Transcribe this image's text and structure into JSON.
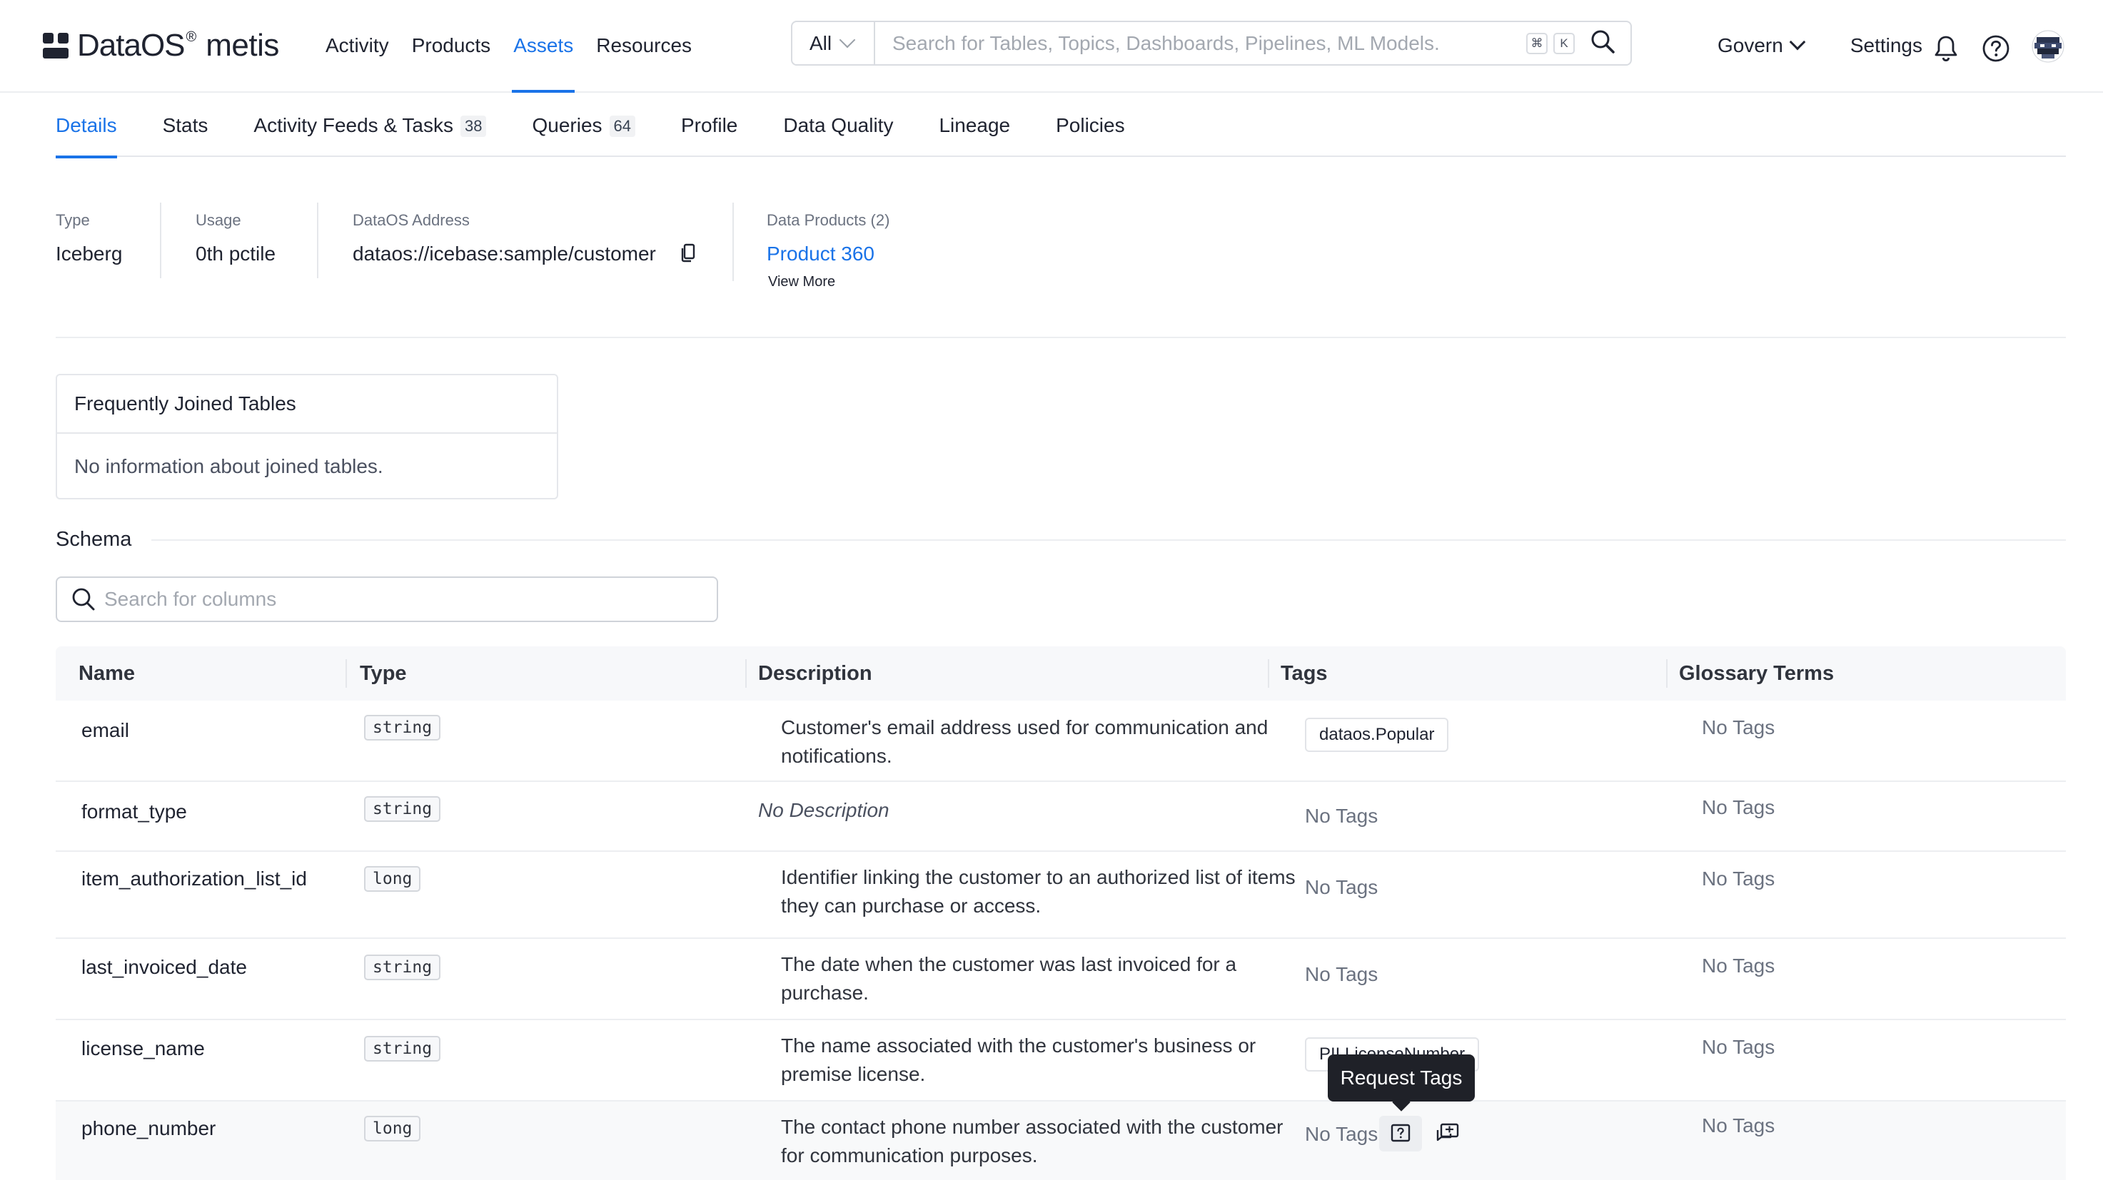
{
  "app": {
    "logo_text": "DataOS",
    "logo_reg": "®",
    "logo_suffix": "metis"
  },
  "nav": {
    "items": [
      "Activity",
      "Products",
      "Assets",
      "Resources"
    ],
    "active": "Assets"
  },
  "search": {
    "filter": "All",
    "placeholder": "Search for Tables, Topics, Dashboards, Pipelines, ML Models.",
    "shortcut_cmd": "⌘",
    "shortcut_key": "K"
  },
  "right_nav": {
    "govern": "Govern",
    "settings": "Settings"
  },
  "tabs": [
    {
      "label": "Details",
      "count": null,
      "active": true
    },
    {
      "label": "Stats",
      "count": null
    },
    {
      "label": "Activity Feeds & Tasks",
      "count": "38"
    },
    {
      "label": "Queries",
      "count": "64"
    },
    {
      "label": "Profile",
      "count": null
    },
    {
      "label": "Data Quality",
      "count": null
    },
    {
      "label": "Lineage",
      "count": null
    },
    {
      "label": "Policies",
      "count": null
    }
  ],
  "summary": {
    "type_label": "Type",
    "type_value": "Iceberg",
    "usage_label": "Usage",
    "usage_value": "0th pctile",
    "address_label": "DataOS Address",
    "address_value": "dataos://icebase:sample/customer",
    "products_label": "Data Products (2)",
    "products_value": "Product 360",
    "view_more": "View More"
  },
  "joined_tables": {
    "title": "Frequently Joined Tables",
    "empty": "No information about joined tables."
  },
  "schema": {
    "title": "Schema",
    "search_placeholder": "Search for columns",
    "columns": [
      "Name",
      "Type",
      "Description",
      "Tags",
      "Glossary Terms"
    ],
    "rows": [
      {
        "name": "email",
        "type": "string",
        "description": "Customer's email address used for communication and notifications.",
        "tag": "dataos.Popular",
        "glossary": "No Tags"
      },
      {
        "name": "format_type",
        "type": "string",
        "description": "No Description",
        "tag": "No Tags",
        "glossary": "No Tags"
      },
      {
        "name": "item_authorization_list_id",
        "type": "long",
        "description": "Identifier linking the customer to an authorized list of items they can purchase or access.",
        "tag": "No Tags",
        "glossary": "No Tags"
      },
      {
        "name": "last_invoiced_date",
        "type": "string",
        "description": "The date when the customer was last invoiced for a purchase.",
        "tag": "No Tags",
        "glossary": "No Tags"
      },
      {
        "name": "license_name",
        "type": "string",
        "description": "The name associated with the customer's business or premise license.",
        "tag": "PII.LicenseNumber",
        "glossary": "No Tags"
      },
      {
        "name": "phone_number",
        "type": "long",
        "description": "The contact phone number associated with the customer for communication purposes.",
        "tag": "No Tags",
        "glossary": "No Tags"
      }
    ]
  },
  "tooltip": {
    "text": "Request Tags"
  },
  "colors": {
    "accent": "#1a73e8",
    "text": "#1f2330",
    "muted": "#6b7280",
    "border": "#e5e7eb"
  }
}
